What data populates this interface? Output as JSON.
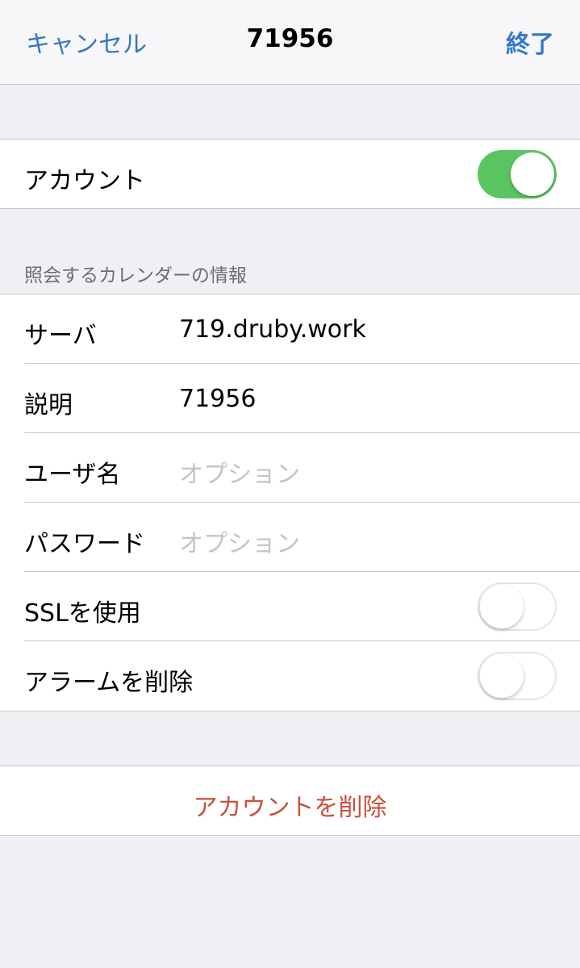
{
  "navbar": {
    "cancel_label": "キャンセル",
    "title": "71956",
    "done_label": "終了"
  },
  "account_group": {
    "label": "アカウント",
    "toggle_on": true
  },
  "server_section": {
    "header": "照会するカレンダーの情報",
    "rows": [
      {
        "label": "サーバ",
        "value": "719.druby.work"
      },
      {
        "label": "説明",
        "value": "71956"
      },
      {
        "label": "ユーザ名",
        "placeholder": "オプション"
      },
      {
        "label": "パスワード",
        "placeholder": "オプション"
      },
      {
        "label": "SSLを使用",
        "toggle_on": false
      },
      {
        "label": "アラームを削除",
        "toggle_on": false
      }
    ]
  },
  "delete_account_label": "アカウントを削除",
  "colors": {
    "accent": "#3478c6",
    "toggle_on": "#5ac560",
    "destructive": "#c8513d",
    "background": "#efeff4"
  }
}
